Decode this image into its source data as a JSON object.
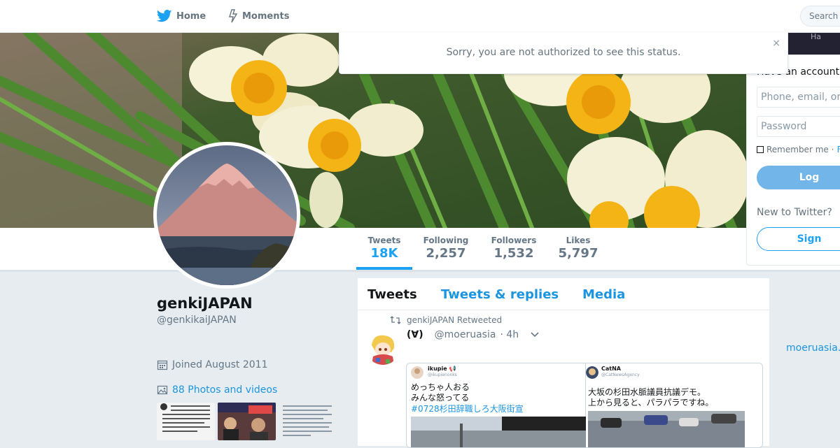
{
  "nav": {
    "home_label": "Home",
    "moments_label": "Moments",
    "search_placeholder": "Search"
  },
  "alert": {
    "message": "Sorry, you are not authorized to see this status.",
    "close_symbol": "×"
  },
  "stats": [
    {
      "label": "Tweets",
      "value": "18K"
    },
    {
      "label": "Following",
      "value": "2,257"
    },
    {
      "label": "Followers",
      "value": "1,532"
    },
    {
      "label": "Likes",
      "value": "5,797"
    }
  ],
  "profile": {
    "name": "genkiJAPAN",
    "handle": "@genkikaiJAPAN",
    "joined": "Joined August 2011",
    "photos_link": "88 Photos and videos"
  },
  "timeline": {
    "tabs": [
      "Tweets",
      "Tweets & replies",
      "Media"
    ],
    "tweet": {
      "retweet_text": "genkiJAPAN Retweeted",
      "name": "(∀)",
      "handle": "@moeruasia",
      "time": "· 4h",
      "quotes": [
        {
          "name": "ikupie 📢",
          "handle": "@ikupienonks",
          "line1": "めっちゃ人おる",
          "line2": "みんな怒ってる",
          "tag": "#0728杉田辞職しろ大阪街宣"
        },
        {
          "name": "CatNA",
          "handle": "@CatNewsAgency",
          "line1": "大坂の杉田水脈議員抗議デモ。",
          "line2": "上から見ると、パラパラですね。"
        }
      ]
    }
  },
  "login": {
    "title": "Have an account",
    "phone_placeholder": "Phone, email, or",
    "password_placeholder": "Password",
    "remember": "Remember me",
    "separator": "·",
    "forgot": "F",
    "login_button": "Log",
    "new_to_twitter": "New to Twitter?",
    "signup_button": "Sign"
  },
  "sidebar_link": "moeruasia.",
  "banner_corner_text": "Ha",
  "colors": {
    "accent": "#1da1f2",
    "link": "#1b95e0",
    "background": "#e6ecf0"
  },
  "icons": {
    "home": "twitter-bird-icon",
    "moments": "lightning-icon",
    "calendar": "calendar-icon",
    "photos": "photo-icon",
    "retweet": "retweet-icon",
    "chevron": "chevron-down-icon"
  }
}
